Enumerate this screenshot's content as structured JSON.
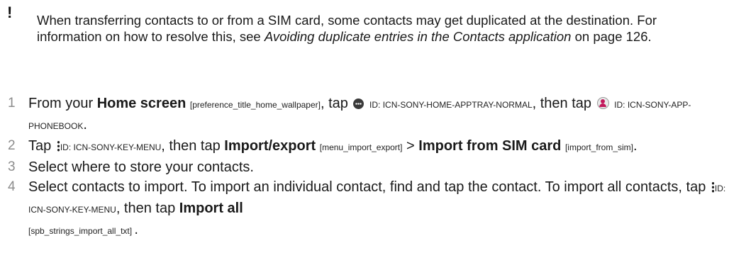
{
  "note": {
    "icon": "exclamation-icon",
    "text_1": "When transferring contacts to or from a SIM card, some contacts may get duplicated at the destination. For information on how to resolve this, see ",
    "link_text": "Avoiding duplicate entries in the Contacts application",
    "text_2": " on page 126."
  },
  "steps": [
    {
      "num": "1",
      "t1": "From your ",
      "b1": "Home screen",
      "tag1": "[preference_title_home_wallpaper]",
      "t2": ", tap ",
      "icon1_tag": "ID: ICN-SONY-HOME-APPTRAY-NORMAL",
      "t3": ", then tap ",
      "icon2_tag": "ID: ICN-SONY-APP-PHONEBOOK",
      "t4": "."
    },
    {
      "num": "2",
      "t1": "Tap ",
      "icon1_tag": "ID: ICN-SONY-KEY-MENU",
      "t2": ", then tap ",
      "b1": "Import/export",
      "tag1": "[menu_import_export]",
      "t3": " > ",
      "b2": "Import from SIM card",
      "tag2": "[import_from_sim]",
      "t4": "."
    },
    {
      "num": "3",
      "text": "Select where to store your contacts."
    },
    {
      "num": "4",
      "t1": "Select contacts to import. To import an individual contact, find and tap the contact. To import all contacts, tap ",
      "icon1_tag": "ID: ICN-SONY-KEY-MENU",
      "t2": ", then tap ",
      "b1": "Import all",
      "tag1": "[spb_strings_import_all_txt]",
      "t3": "."
    }
  ]
}
